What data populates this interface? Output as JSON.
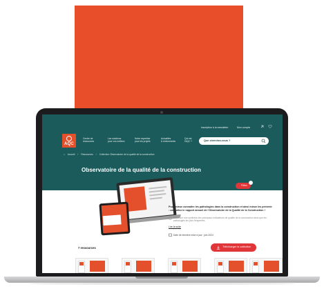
{
  "utility": {
    "newsletter": "Inscription à la newsletter",
    "account": "Mon compte"
  },
  "logo": {
    "text": "AQC"
  },
  "nav": {
    "items": [
      {
        "label": "Centre de\nressources"
      },
      {
        "label": "Les solutions\npour vos métiers"
      },
      {
        "label": "Notre expertise\npour les projets"
      },
      {
        "label": "Actualités\n& événements"
      },
      {
        "label": "Qui est\nl'AQC ?"
      }
    ]
  },
  "search": {
    "placeholder": "Que cherchez-vous ?"
  },
  "breadcrumb": {
    "items": [
      "Accueil",
      "›",
      "Ressources",
      "›",
      "Collection Observatoire de la qualité de la construction"
    ]
  },
  "hero": {
    "title": "Observatoire de la qualité de la construction"
  },
  "filter": {
    "label": "Filtrer"
  },
  "intro": {
    "text": "Pour mieux connaître les pathologies dans la construction et ainsi mieux les prévenir : consultez le rapport annuel de l'Observatoire de la Qualité de la Construction !",
    "detail": "Découvrir une synthèse des principaux indicateurs de qualité de la construction ainsi que les pathologies les plus fréquentes.",
    "more": "Lire la suite",
    "updated": "Date de dernière mise à jour : juin 2024"
  },
  "resources": {
    "title": "7 ressources",
    "download_label": "Télécharger la collection"
  },
  "colors": {
    "brand_teal": "#1b5b5c",
    "brand_orange": "#e4502c",
    "cta_red": "#e0363a"
  }
}
